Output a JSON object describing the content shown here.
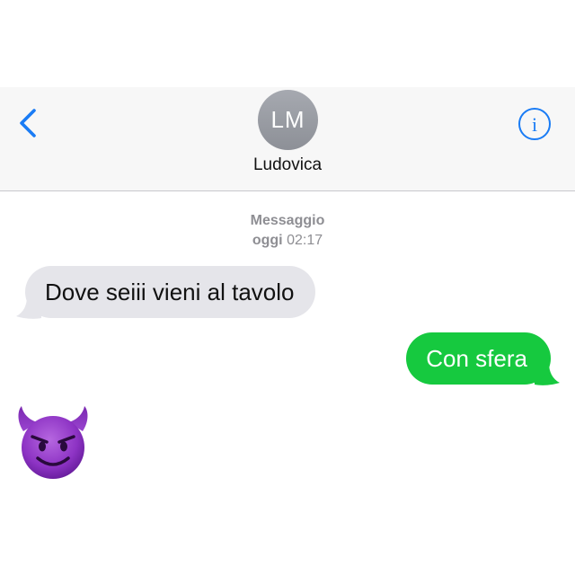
{
  "header": {
    "avatar_initials": "LM",
    "contact_name": "Ludovica",
    "back_icon": "chevron-left-icon",
    "info_icon": "info-icon",
    "accent_color": "#1a7cf5"
  },
  "conversation": {
    "timestamp_label": "Messaggio",
    "timestamp_day": "oggi",
    "timestamp_time": "02:17",
    "messages": [
      {
        "direction": "incoming",
        "text": "Dove seiii vieni al tavolo",
        "color": "#e5e5ea"
      },
      {
        "direction": "outgoing",
        "text": "Con sfera",
        "color": "#16c93f"
      },
      {
        "direction": "incoming",
        "emoji": "smiling-devil-emoji"
      }
    ]
  }
}
